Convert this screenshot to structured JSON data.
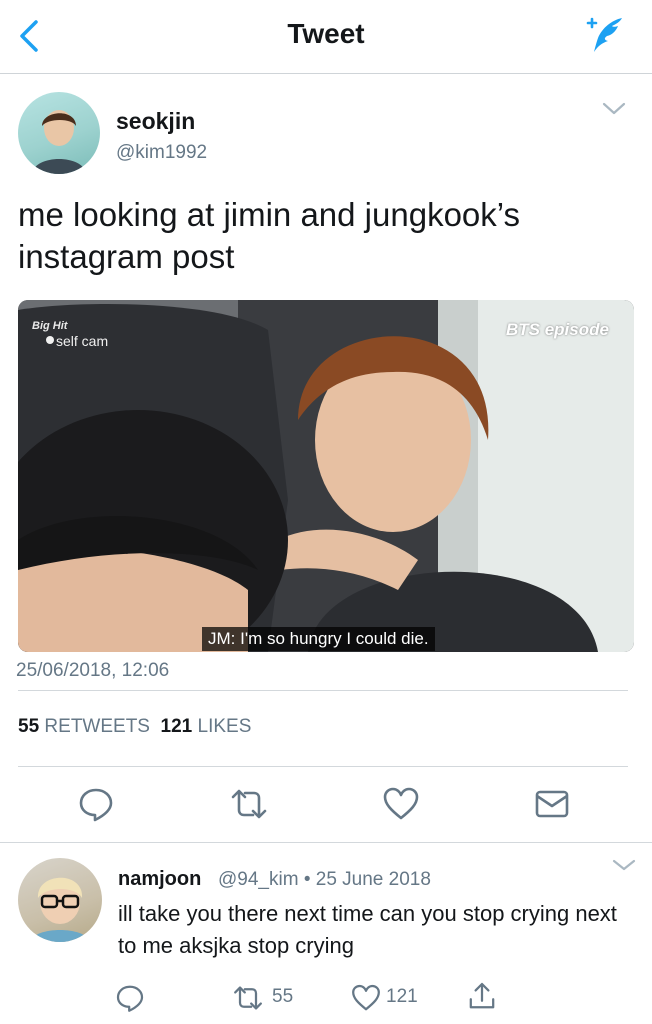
{
  "header": {
    "title": "Tweet"
  },
  "tweet": {
    "author_name": "seokjin",
    "author_handle": "@kim1992",
    "text": "me looking at jimin and jungkook’s instagram post",
    "media": {
      "corner_logo": "Big Hit",
      "cam_label": "self cam",
      "watermark": "BTS episode",
      "subtitle": "JM: I'm so hungry I could die."
    },
    "timestamp": "25/06/2018, 12:06",
    "retweets": "55",
    "retweets_label": "RETWEETS",
    "likes": "121",
    "likes_label": "LIKES"
  },
  "reply": {
    "author_name": "namjoon",
    "meta": "@94_kim • 25 June 2018",
    "text": "ill take you there next time can you stop crying next to me aksjka stop crying",
    "retweets": "55",
    "likes": "121"
  },
  "colors": {
    "accent": "#1da1f2",
    "secondary_text": "#657786",
    "divider": "#d3d8dc"
  },
  "icons": [
    "back-chevron-icon",
    "compose-feather-icon",
    "chevron-down-icon",
    "reply-icon",
    "retweet-icon",
    "like-heart-icon",
    "message-icon",
    "share-icon"
  ]
}
